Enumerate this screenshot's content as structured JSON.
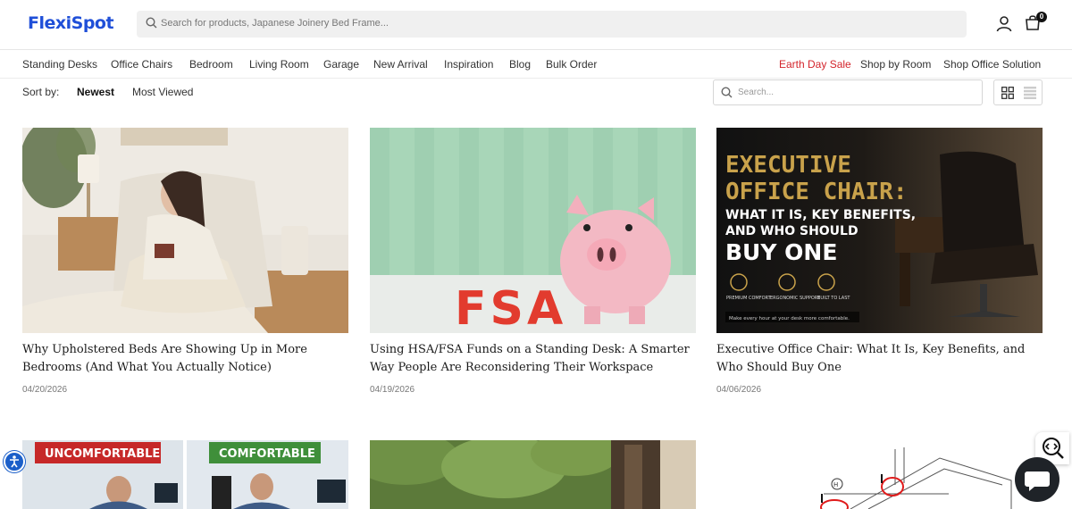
{
  "header": {
    "logo": "FlexiSpot",
    "search_placeholder": "Search for products, Japanese Joinery Bed Frame...",
    "cart_count": "0"
  },
  "nav": {
    "left": [
      "Standing Desks",
      "Office Chairs",
      "Bedroom",
      "Living Room",
      "Garage",
      "New Arrival",
      "Inspiration",
      "Blog",
      "Bulk Order"
    ],
    "right": [
      "Earth Day Sale",
      "Shop by Room",
      "Shop Office Solution"
    ]
  },
  "sort": {
    "label": "Sort by:",
    "options": [
      "Newest",
      "Most Viewed"
    ],
    "active": "Newest"
  },
  "blog_search": {
    "placeholder": "Search..."
  },
  "articles": [
    {
      "title": "Why Upholstered Beds Are Showing Up in More Bedrooms (And What You Actually Notice)",
      "date": "04/20/2026"
    },
    {
      "title": "Using HSA/FSA Funds on a Standing Desk: A Smarter Way People Are Reconsidering Their Workspace",
      "date": "04/19/2026"
    },
    {
      "title": "Executive Office Chair: What It Is, Key Benefits, and Who Should Buy One",
      "date": "04/06/2026"
    }
  ],
  "image_text": {
    "fsa": "FSA",
    "chair_title_1": "EXECUTIVE",
    "chair_title_2": "OFFICE CHAIR:",
    "chair_title_3": "WHAT IT IS, KEY BENEFITS,",
    "chair_title_4": "AND WHO SHOULD",
    "chair_title_5": "BUY ONE",
    "badge_1": "PREMIUM COMFORT",
    "badge_2": "ERGONOMIC SUPPORT",
    "badge_3": "BUILT TO LAST",
    "chair_footer": "Make every hour at your desk more comfortable.",
    "uncomfortable": "UNCOMFORTABLE",
    "comfortable": "COMFORTABLE",
    "diagram_h": "H"
  },
  "colors": {
    "brand": "#1f4fd8",
    "sale": "#d3242b",
    "uncomfortable_bg": "#c62828",
    "comfortable_bg": "#3f8f3a"
  }
}
